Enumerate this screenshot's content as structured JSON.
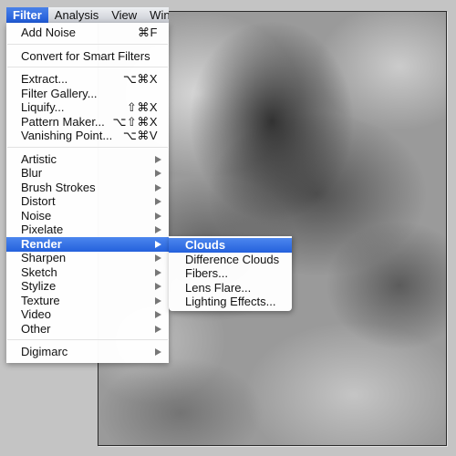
{
  "menubar": {
    "items": [
      {
        "label": "Filter",
        "active": true
      },
      {
        "label": "Analysis"
      },
      {
        "label": "View"
      },
      {
        "label": "Wind"
      }
    ]
  },
  "filter_menu": {
    "groups": [
      [
        {
          "label": "Add Noise",
          "shortcut": "⌘F"
        }
      ],
      [
        {
          "label": "Convert for Smart Filters"
        }
      ],
      [
        {
          "label": "Extract...",
          "shortcut": "⌥⌘X"
        },
        {
          "label": "Filter Gallery..."
        },
        {
          "label": "Liquify...",
          "shortcut": "⇧⌘X"
        },
        {
          "label": "Pattern Maker...",
          "shortcut": "⌥⇧⌘X"
        },
        {
          "label": "Vanishing Point...",
          "shortcut": "⌥⌘V"
        }
      ],
      [
        {
          "label": "Artistic",
          "submenu": true
        },
        {
          "label": "Blur",
          "submenu": true
        },
        {
          "label": "Brush Strokes",
          "submenu": true
        },
        {
          "label": "Distort",
          "submenu": true
        },
        {
          "label": "Noise",
          "submenu": true
        },
        {
          "label": "Pixelate",
          "submenu": true
        },
        {
          "label": "Render",
          "submenu": true,
          "selected": true
        },
        {
          "label": "Sharpen",
          "submenu": true
        },
        {
          "label": "Sketch",
          "submenu": true
        },
        {
          "label": "Stylize",
          "submenu": true
        },
        {
          "label": "Texture",
          "submenu": true
        },
        {
          "label": "Video",
          "submenu": true
        },
        {
          "label": "Other",
          "submenu": true
        }
      ],
      [
        {
          "label": "Digimarc",
          "submenu": true
        }
      ]
    ]
  },
  "render_submenu": {
    "items": [
      {
        "label": "Clouds",
        "selected": true
      },
      {
        "label": "Difference Clouds"
      },
      {
        "label": "Fibers..."
      },
      {
        "label": "Lens Flare..."
      },
      {
        "label": "Lighting Effects..."
      }
    ]
  },
  "colors": {
    "highlight": "#2461dc",
    "background": "#c4c4c4"
  }
}
